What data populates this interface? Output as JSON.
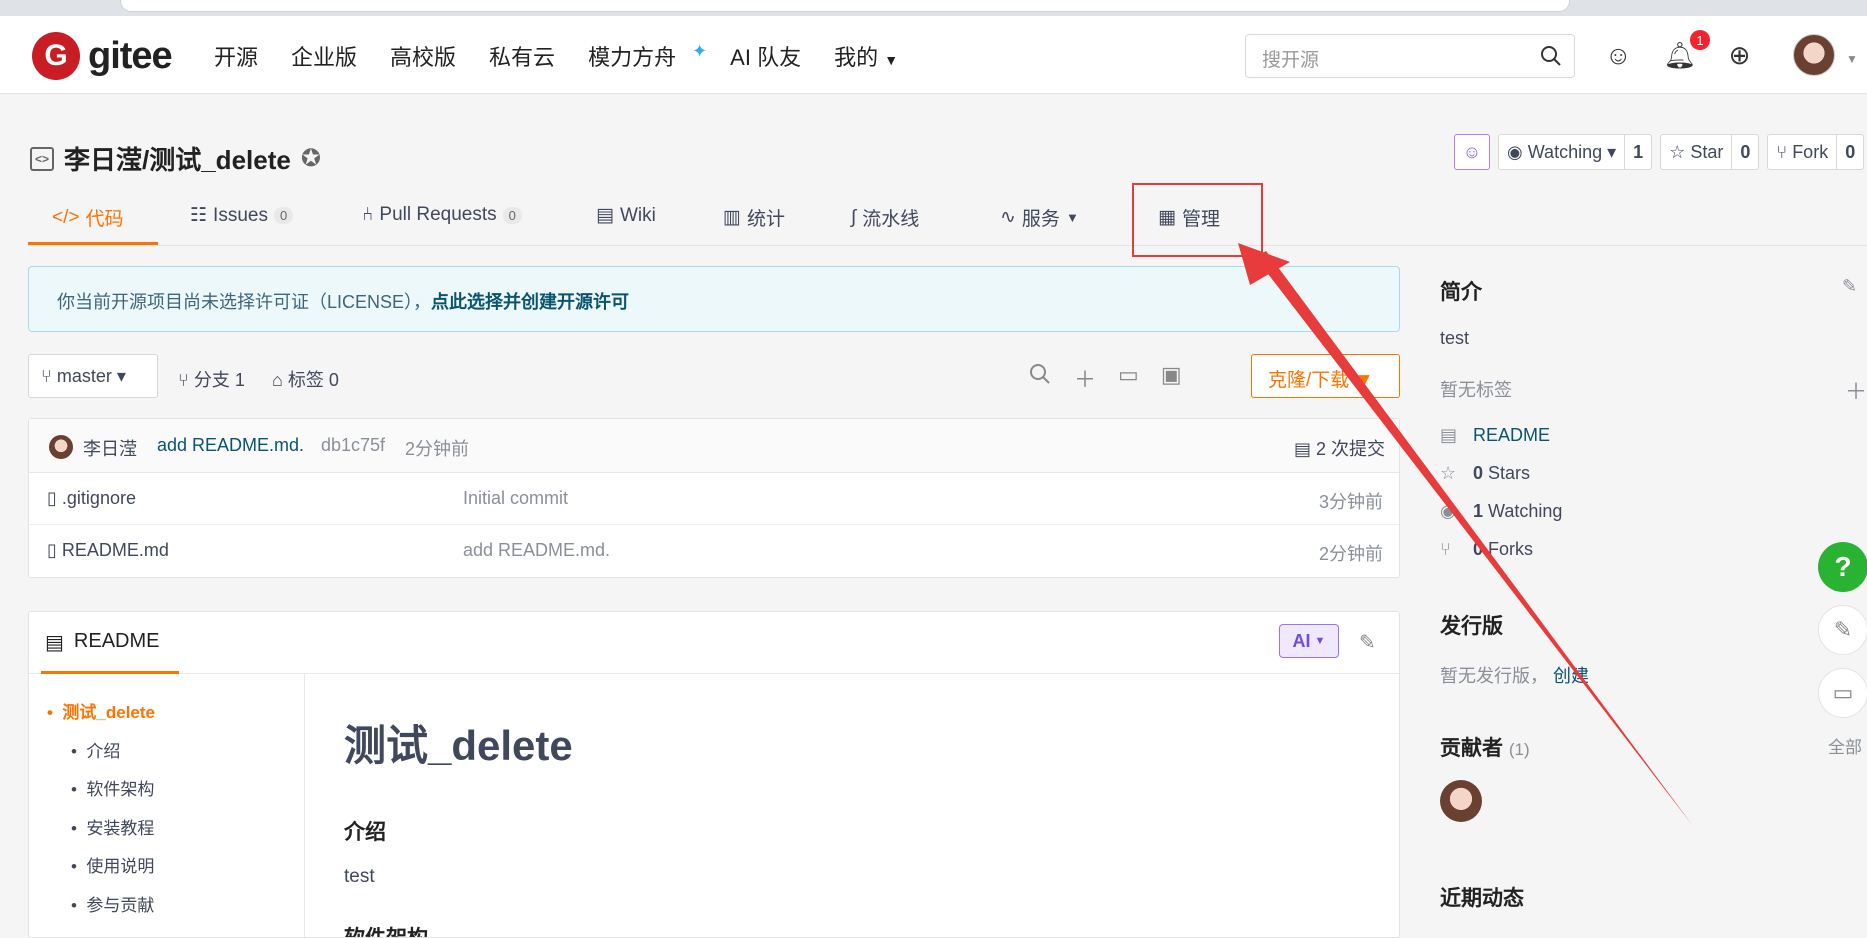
{
  "header": {
    "logo_text": "gitee",
    "logo_mark": "G",
    "nav": [
      "开源",
      "企业版",
      "高校版",
      "私有云",
      "模力方舟",
      "AI 队友",
      "我的"
    ],
    "nav_spark": "✦",
    "search_placeholder": "搜开源",
    "notification_count": "1"
  },
  "repo": {
    "title": "李日滢/测试_delete",
    "watching_label": "Watching",
    "watching_count": "1",
    "star_label": "Star",
    "star_count": "0",
    "fork_label": "Fork",
    "fork_count": "0"
  },
  "tabs": [
    {
      "label": "代码",
      "icon": "</>"
    },
    {
      "label": "Issues",
      "count": "0"
    },
    {
      "label": "Pull Requests",
      "count": "0"
    },
    {
      "label": "Wiki"
    },
    {
      "label": "统计"
    },
    {
      "label": "流水线"
    },
    {
      "label": "服务"
    },
    {
      "label": "管理"
    }
  ],
  "license": {
    "text": "你当前开源项目尚未选择许可证（LICENSE），",
    "link": "点此选择并创建开源许可"
  },
  "toolbar": {
    "branch": "master",
    "branches": "分支 1",
    "tags": "标签 0",
    "clone": "克隆/下载"
  },
  "commit": {
    "author": "李日滢",
    "message": "add README.md.",
    "hash": "db1c75f",
    "time": "2分钟前",
    "count": "2 次提交"
  },
  "files": [
    {
      "name": ".gitignore",
      "commit": "Initial commit",
      "time": "3分钟前"
    },
    {
      "name": "README.md",
      "commit": "add README.md.",
      "time": "2分钟前"
    }
  ],
  "readme": {
    "tab": "README",
    "ai": "AI",
    "toc": [
      "测试_delete",
      "介绍",
      "软件架构",
      "安装教程",
      "使用说明",
      "参与贡献"
    ],
    "h1": "测试_delete",
    "h3": "介绍",
    "body": "test",
    "next_heading": "软件架构"
  },
  "sidebar": {
    "intro_title": "简介",
    "intro_text": "test",
    "no_tags": "暂无标签",
    "readme_link": "README",
    "stars_num": "0",
    "stars_label": "Stars",
    "watching_num": "1",
    "watching_label": "Watching",
    "forks_num": "0",
    "forks_label": "Forks",
    "release_title": "发行版",
    "release_text": "暂无发行版，",
    "release_link": "创建",
    "contrib_title": "贡献者",
    "contrib_count": "(1)",
    "activity_title": "近期动态"
  },
  "float": {
    "help": "?",
    "all_label": "全部"
  },
  "colors": {
    "accent": "#fe7300",
    "annotation": "#e83b3b",
    "brand": "#c71d23"
  }
}
